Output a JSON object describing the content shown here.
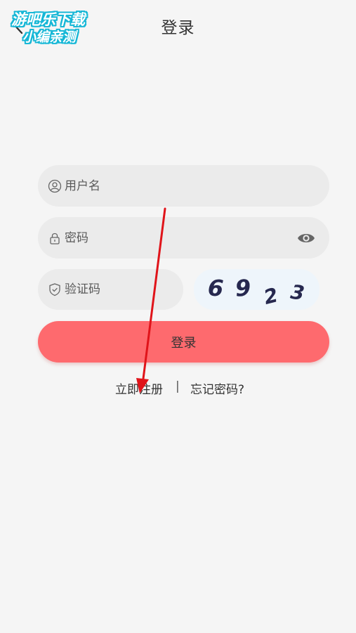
{
  "header": {
    "title": "登录",
    "back_icon": "chevron-left-icon"
  },
  "watermark": {
    "line1": "游吧乐下载",
    "line2": "小编亲测"
  },
  "form": {
    "username": {
      "placeholder": "用户名",
      "icon": "user-icon"
    },
    "password": {
      "placeholder": "密码",
      "icon": "lock-icon",
      "toggle_icon": "eye-icon"
    },
    "captcha_field": {
      "placeholder": "验证码",
      "icon": "shield-icon"
    },
    "captcha_text": [
      "6",
      "9",
      "2",
      "3"
    ],
    "login_label": "登录"
  },
  "links": {
    "register": "立即注册",
    "separator": "|",
    "forgot": "忘记密码?"
  },
  "colors": {
    "background": "#f5f5f5",
    "field": "#ebebeb",
    "primary": "#fe6a6e",
    "captcha_bg": "#eef5fb",
    "captcha_text": "#26284f",
    "annotation_arrow": "#e0141a"
  }
}
